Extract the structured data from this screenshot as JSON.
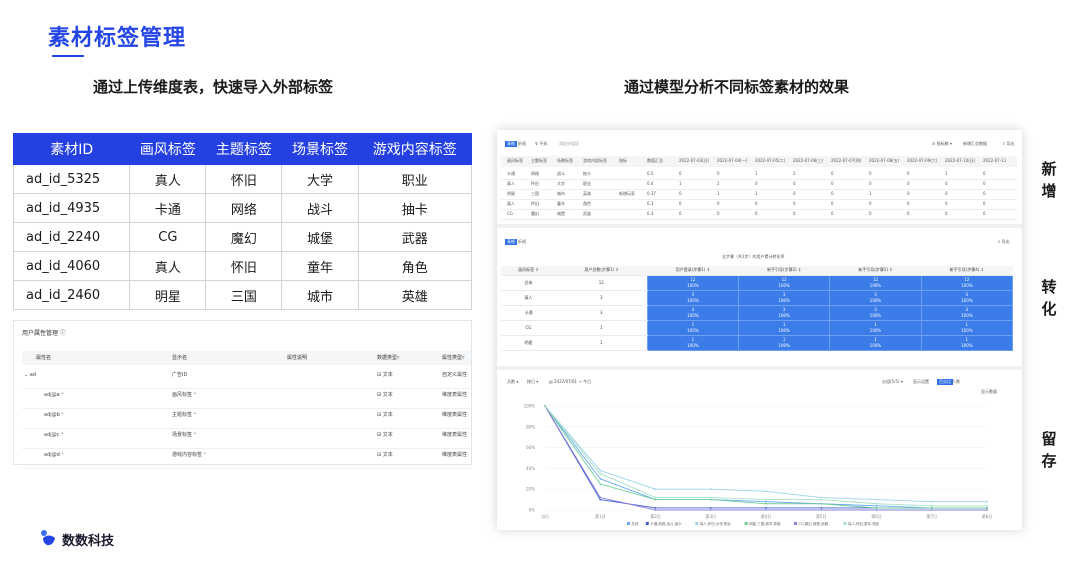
{
  "page": {
    "title": "素材标签管理",
    "subtitle_left": "通过上传维度表，快速导入外部标签",
    "subtitle_right": "通过模型分析不同标签素材的效果",
    "brand": "数数科技",
    "side_labels": [
      "新增",
      "转化",
      "留存"
    ]
  },
  "tag_table": {
    "headers": [
      "素材ID",
      "画风标签",
      "主题标签",
      "场景标签",
      "游戏内容标签"
    ],
    "rows": [
      [
        "ad_id_5325",
        "真人",
        "怀旧",
        "大学",
        "职业"
      ],
      [
        "ad_id_4935",
        "卡通",
        "网络",
        "战斗",
        "抽卡"
      ],
      [
        "ad_id_2240",
        "CG",
        "魔幻",
        "城堡",
        "武器"
      ],
      [
        "ad_id_4060",
        "真人",
        "怀旧",
        "童年",
        "角色"
      ],
      [
        "ad_id_2460",
        "明星",
        "三国",
        "城市",
        "英雄"
      ]
    ]
  },
  "attr_panel": {
    "title": "用户属性管理 ⓘ",
    "headers": [
      "属性名",
      "显示名",
      "属性说明",
      "数据类型▿",
      "属性类型▿"
    ],
    "rows": [
      [
        "⌄ ad",
        "广告ID",
        "",
        "⊟ 文本",
        "自定义属性"
      ],
      [
        "adj@a ⁺",
        "画风标签 ⁺",
        "",
        "⊟ 文本",
        "维度表属性"
      ],
      [
        "adj@b ⁺",
        "主题标签 ⁺",
        "",
        "⊟ 文本",
        "维度表属性"
      ],
      [
        "adj@c ⁺",
        "场景标签 ⁺",
        "",
        "⊟ 文本",
        "维度表属性"
      ],
      [
        "adj@d ⁺",
        "游戏内容标签 ⁺",
        "",
        "⊟ 文本",
        "维度表属性"
      ]
    ]
  },
  "mock_section1": {
    "toolbar": [
      "表格",
      "折线",
      "⊽ 不拆",
      "添加分组项"
    ],
    "toolbar_right": [
      "⊟ 指标数 ▾",
      "新增汇总数据",
      "⇩ 导出"
    ],
    "headers": [
      "画风标签",
      "主题标签",
      "场景标签",
      "游戏内容标签",
      "指标",
      "数值汇总",
      "2022-07-03(日)",
      "2022-07-04(一)",
      "2022-07-05(二)",
      "2022-07-06(三)",
      "2022-07-07(四)",
      "2022-07-08(五)",
      "2022-07-09(六)",
      "2022-07-10(日)",
      "2022-07-11"
    ],
    "rows": [
      [
        "卡通",
        "网络",
        "战斗",
        "抽卡",
        "",
        "0.5",
        "0",
        "0",
        "1",
        "2",
        "0",
        "0",
        "0",
        "1",
        "0"
      ],
      [
        "真人",
        "怀旧",
        "大学",
        "职业",
        "",
        "0.4",
        "1",
        "2",
        "0",
        "0",
        "0",
        "0",
        "0",
        "0",
        "0"
      ],
      [
        "明星",
        "三国",
        "城市",
        "英雄",
        "新增玩家",
        "0.37",
        "0",
        "1",
        "1",
        "0",
        "0",
        "1",
        "0",
        "0",
        "0"
      ],
      [
        "真人",
        "怀旧",
        "童年",
        "角色",
        "",
        "0.3",
        "0",
        "0",
        "0",
        "0",
        "0",
        "0",
        "0",
        "0",
        "0"
      ],
      [
        "CG",
        "魔幻",
        "城堡",
        "武器",
        "",
        "0.3",
        "0",
        "0",
        "0",
        "0",
        "0",
        "0",
        "0",
        "0",
        "0"
      ]
    ]
  },
  "mock_section2": {
    "toolbar": [
      "表格",
      "折线"
    ],
    "export": "⇩ 导出",
    "caption": "全步骤（共1步）的用户累计转化率",
    "headers": [
      "画风标签 ↕",
      "用户总数(步骤1) ↕",
      "用户登录(步骤1) ↕",
      "新手引导(步骤2) ↕",
      "新手引导(步骤3) ↕",
      "新手引导(步骤4) ↕"
    ],
    "rows": [
      [
        "总体",
        "12",
        "12\n100%",
        "12\n100%",
        "12\n100%",
        "12\n100%"
      ],
      [
        "真人",
        "3",
        "3\n100%",
        "3\n100%",
        "3\n100%",
        "3\n100%"
      ],
      [
        "卡通",
        "3",
        "3\n100%",
        "3\n100%",
        "3\n100%",
        "3\n100%"
      ],
      [
        "CG",
        "1",
        "1\n100%",
        "1\n100%",
        "1\n100%",
        "1\n100%"
      ],
      [
        "明星",
        "1",
        "1\n100%",
        "1\n100%",
        "1\n100%",
        "1\n100%"
      ]
    ]
  },
  "mock_section3": {
    "toolbar_left": [
      "天数 ▾",
      "按日 ▾",
      "▤ 2022/07/01 → 今日"
    ],
    "toolbar_right": [
      "分组(5/5) ▾",
      "显示设置",
      "百分比",
      "人数"
    ],
    "hint": "显示数量",
    "y_ticks": [
      "100%",
      "80%",
      "60%",
      "40%",
      "20%",
      "0%"
    ],
    "x_ticks": [
      "当日",
      "第1日",
      "第2日",
      "第3日",
      "第4日",
      "第5日",
      "第6日",
      "第7日",
      "第8日"
    ],
    "legend": [
      "总体",
      "卡通,网络,战斗,抽卡",
      "真人,怀旧,大学,职业",
      "明星,三国,城市,英雄",
      "CG,魔幻,城堡,武器",
      "真人,怀旧,童年,角色"
    ]
  },
  "chart_data": {
    "type": "line",
    "x": [
      "当日",
      "第1日",
      "第2日",
      "第3日",
      "第4日",
      "第5日",
      "第6日",
      "第7日",
      "第8日"
    ],
    "ylim": [
      0,
      100
    ],
    "series": [
      {
        "name": "总体",
        "values": [
          100,
          30,
          10,
          10,
          8,
          6,
          4,
          2,
          2
        ],
        "color": "#6aa6f5"
      },
      {
        "name": "卡通,网络,战斗,抽卡",
        "values": [
          100,
          10,
          2,
          2,
          2,
          2,
          2,
          2,
          2
        ],
        "color": "#3f5fd0"
      },
      {
        "name": "真人,怀旧,大学,职业",
        "values": [
          100,
          38,
          20,
          20,
          18,
          12,
          10,
          8,
          8
        ],
        "color": "#9ed3e8"
      },
      {
        "name": "明星,三国,城市,英雄",
        "values": [
          100,
          25,
          10,
          10,
          6,
          6,
          2,
          2,
          2
        ],
        "color": "#6fcf97"
      },
      {
        "name": "CG,魔幻,城堡,武器",
        "values": [
          100,
          12,
          0,
          0,
          0,
          0,
          0,
          0,
          0
        ],
        "color": "#8a7fd6"
      },
      {
        "name": "真人,怀旧,童年,角色",
        "values": [
          100,
          35,
          12,
          12,
          10,
          10,
          6,
          4,
          4
        ],
        "color": "#a7e0c8"
      }
    ]
  }
}
